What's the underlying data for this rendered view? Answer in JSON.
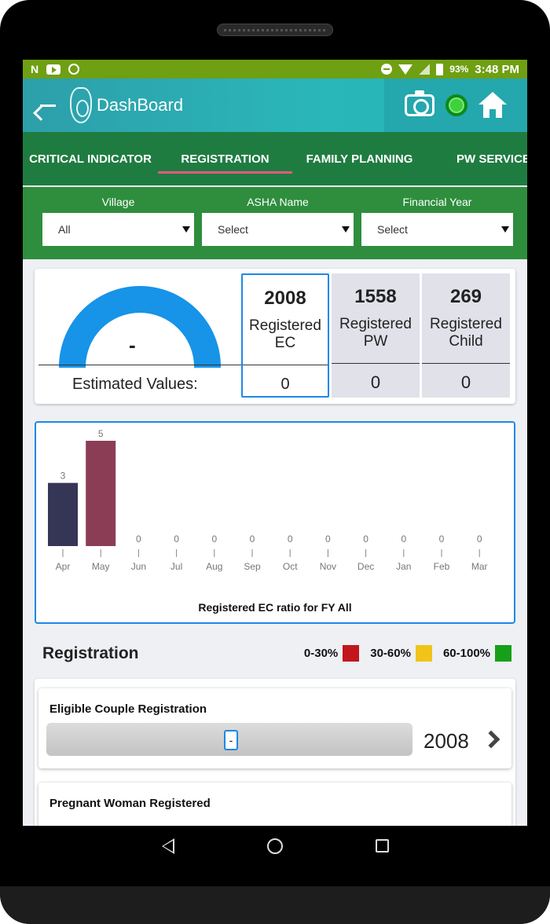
{
  "status_bar": {
    "battery": "93%",
    "time": "3:48 PM"
  },
  "app_bar": {
    "title": "DashBoard"
  },
  "tabs": [
    {
      "label": "CRITICAL INDICATOR",
      "active": false
    },
    {
      "label": "REGISTRATION",
      "active": true
    },
    {
      "label": "FAMILY PLANNING",
      "active": false
    },
    {
      "label": "PW SERVICES",
      "active": false
    }
  ],
  "filters": [
    {
      "label": "Village",
      "value": "All"
    },
    {
      "label": "ASHA Name",
      "value": "Select"
    },
    {
      "label": "Financial Year",
      "value": "Select"
    }
  ],
  "stats": {
    "gauge_value": "-",
    "estimated_label": "Estimated Values:",
    "columns": [
      {
        "value": "2008",
        "label": "Registered EC",
        "estimated": "0"
      },
      {
        "value": "1558",
        "label": "Registered PW",
        "estimated": "0"
      },
      {
        "value": "269",
        "label": "Registered Child",
        "estimated": "0"
      }
    ]
  },
  "chart_data": {
    "type": "bar",
    "title": "Registered EC ratio for FY All",
    "categories": [
      "Apr",
      "May",
      "Jun",
      "Jul",
      "Aug",
      "Sep",
      "Oct",
      "Nov",
      "Dec",
      "Jan",
      "Feb",
      "Mar"
    ],
    "values": [
      3,
      5,
      0,
      0,
      0,
      0,
      0,
      0,
      0,
      0,
      0,
      0
    ],
    "bar_colors": [
      "#353556",
      "#8a3d55",
      "#888888",
      "#888888",
      "#888888",
      "#888888",
      "#888888",
      "#888888",
      "#888888",
      "#888888",
      "#888888",
      "#888888"
    ],
    "ylim": [
      0,
      5
    ]
  },
  "registration": {
    "heading": "Registration",
    "legend": [
      {
        "label": "0-30%",
        "color": "#c3161c"
      },
      {
        "label": "30-60%",
        "color": "#f0c419"
      },
      {
        "label": "60-100%",
        "color": "#16a017"
      }
    ],
    "items": [
      {
        "name": "Eligible Couple Registration",
        "marker": "-",
        "value": "2008"
      },
      {
        "name": "Pregnant Woman Registered"
      }
    ]
  },
  "icons": [
    "back-arrow-icon",
    "app-logo-icon",
    "camera-icon",
    "sync-status-icon",
    "home-icon",
    "chevron-right-icon",
    "nav-back-icon",
    "nav-home-icon",
    "nav-recents-icon"
  ]
}
